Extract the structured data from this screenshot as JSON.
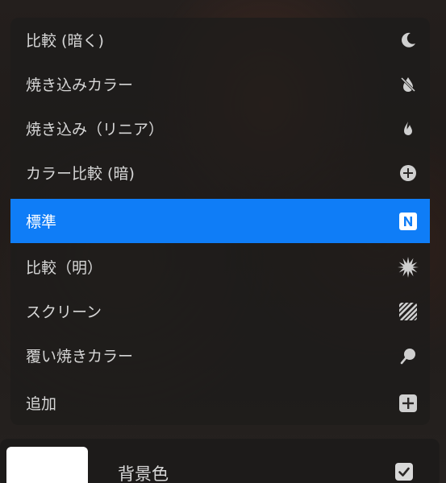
{
  "blend_menu": {
    "items": [
      {
        "label": "比較 (暗く)",
        "icon": "moon-icon"
      },
      {
        "label": "焼き込みカラー",
        "icon": "burn-drop-icon"
      },
      {
        "label": "焼き込み（リニア）",
        "icon": "flame-icon"
      },
      {
        "label": "カラー比較 (暗)",
        "icon": "plus-circle-icon"
      },
      {
        "label": "標準",
        "icon": "normal-n-icon",
        "selected": true
      },
      {
        "label": "比較（明）",
        "icon": "starburst-icon"
      },
      {
        "label": "スクリーン",
        "icon": "stripes-icon"
      },
      {
        "label": "覆い焼きカラー",
        "icon": "dodge-tool-icon"
      },
      {
        "label": "追加",
        "icon": "plus-square-icon"
      }
    ]
  },
  "layer": {
    "label": "背景色",
    "checked": true,
    "icon": "checkbox-checked-icon"
  },
  "colors": {
    "accent": "#0f7df7",
    "text": "#d6d6d6",
    "icon": "#cfcfcf"
  }
}
